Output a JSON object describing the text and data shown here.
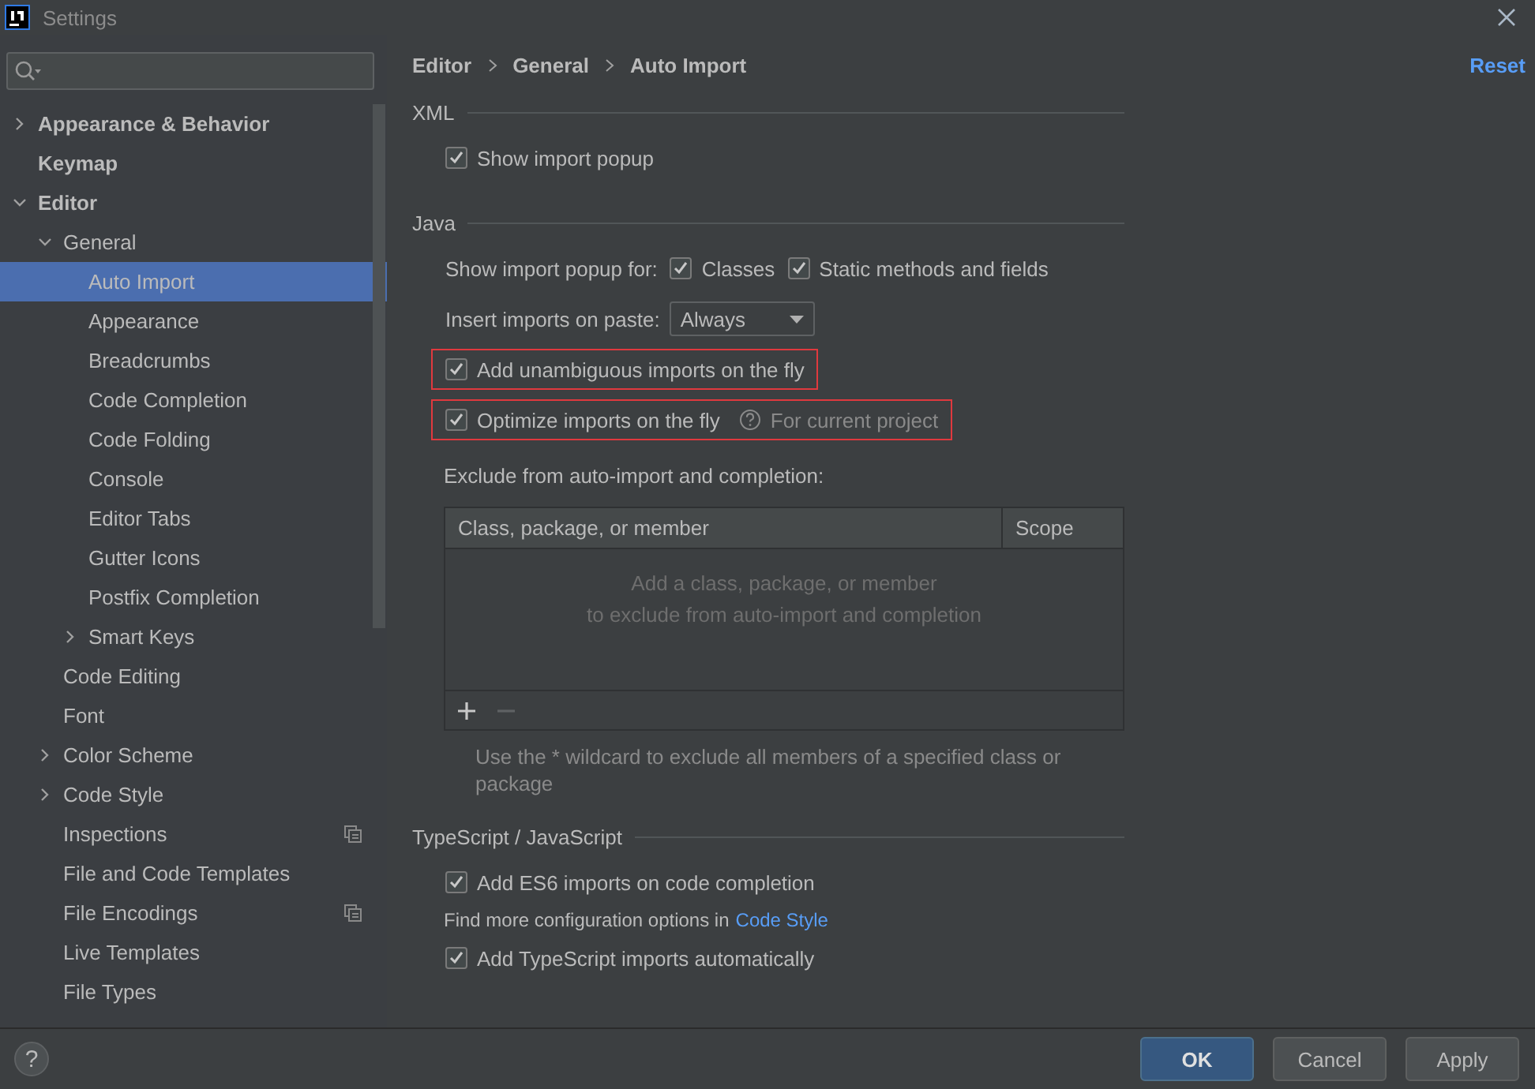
{
  "window": {
    "title": "Settings"
  },
  "sidebar": {
    "items": [
      {
        "label": "Appearance & Behavior",
        "expanded": false,
        "selected": false
      },
      {
        "label": "Keymap",
        "selected": false
      },
      {
        "label": "Editor",
        "expanded": true,
        "selected": false,
        "children": [
          {
            "label": "General",
            "expanded": true,
            "selected": false,
            "children": [
              {
                "label": "Auto Import",
                "selected": true
              },
              {
                "label": "Appearance",
                "selected": false
              },
              {
                "label": "Breadcrumbs",
                "selected": false
              },
              {
                "label": "Code Completion",
                "selected": false
              },
              {
                "label": "Code Folding",
                "selected": false
              },
              {
                "label": "Console",
                "selected": false
              },
              {
                "label": "Editor Tabs",
                "selected": false
              },
              {
                "label": "Gutter Icons",
                "selected": false
              },
              {
                "label": "Postfix Completion",
                "selected": false
              },
              {
                "label": "Smart Keys",
                "expanded": false,
                "selected": false
              }
            ]
          },
          {
            "label": "Code Editing",
            "selected": false
          },
          {
            "label": "Font",
            "selected": false
          },
          {
            "label": "Color Scheme",
            "expanded": false,
            "selected": false
          },
          {
            "label": "Code Style",
            "expanded": false,
            "selected": false
          },
          {
            "label": "Inspections",
            "selected": false,
            "project_scope": true
          },
          {
            "label": "File and Code Templates",
            "selected": false
          },
          {
            "label": "File Encodings",
            "selected": false,
            "project_scope": true
          },
          {
            "label": "Live Templates",
            "selected": false
          },
          {
            "label": "File Types",
            "selected": false
          }
        ]
      }
    ]
  },
  "breadcrumb": [
    "Editor",
    "General",
    "Auto Import"
  ],
  "reset": "Reset",
  "sections": [
    {
      "title": "XML",
      "rows": [
        {
          "kind": "checkbox",
          "label": "Show import popup",
          "checked": true,
          "highlighted": false
        }
      ]
    },
    {
      "title": "Java",
      "rows": [
        {
          "kind": "checkgroup",
          "label": "Show import popup for:",
          "options": [
            {
              "label": "Classes",
              "checked": true
            },
            {
              "label": "Static methods and fields",
              "checked": true
            }
          ]
        },
        {
          "kind": "select",
          "label": "Insert imports on paste:",
          "value": "Always"
        },
        {
          "kind": "checkbox",
          "label": "Add unambiguous imports on the fly",
          "checked": true,
          "highlighted": true
        },
        {
          "kind": "checkbox",
          "label": "Optimize imports on the fly",
          "checked": true,
          "highlighted": true,
          "hint": "For current project"
        },
        {
          "kind": "table",
          "label": "Exclude from auto-import and completion:",
          "columns": [
            "Class, package, or member",
            "Scope"
          ],
          "empty_text": [
            "Add a class, package, or member",
            "to exclude from auto-import and completion"
          ],
          "note": "Use the * wildcard to exclude all members of a specified class or package"
        }
      ]
    },
    {
      "title": "TypeScript / JavaScript",
      "rows": [
        {
          "kind": "checkbox",
          "label": "Add ES6 imports on code completion",
          "checked": true,
          "highlighted": false
        },
        {
          "kind": "link_text",
          "text": "Find more configuration options in",
          "link": "Code Style"
        },
        {
          "kind": "checkbox",
          "label": "Add TypeScript imports automatically",
          "checked": true,
          "highlighted": false
        }
      ]
    }
  ],
  "help": "?",
  "buttons": [
    {
      "label": "OK",
      "default": true
    },
    {
      "label": "Cancel",
      "default": false
    },
    {
      "label": "Apply",
      "default": false
    }
  ]
}
